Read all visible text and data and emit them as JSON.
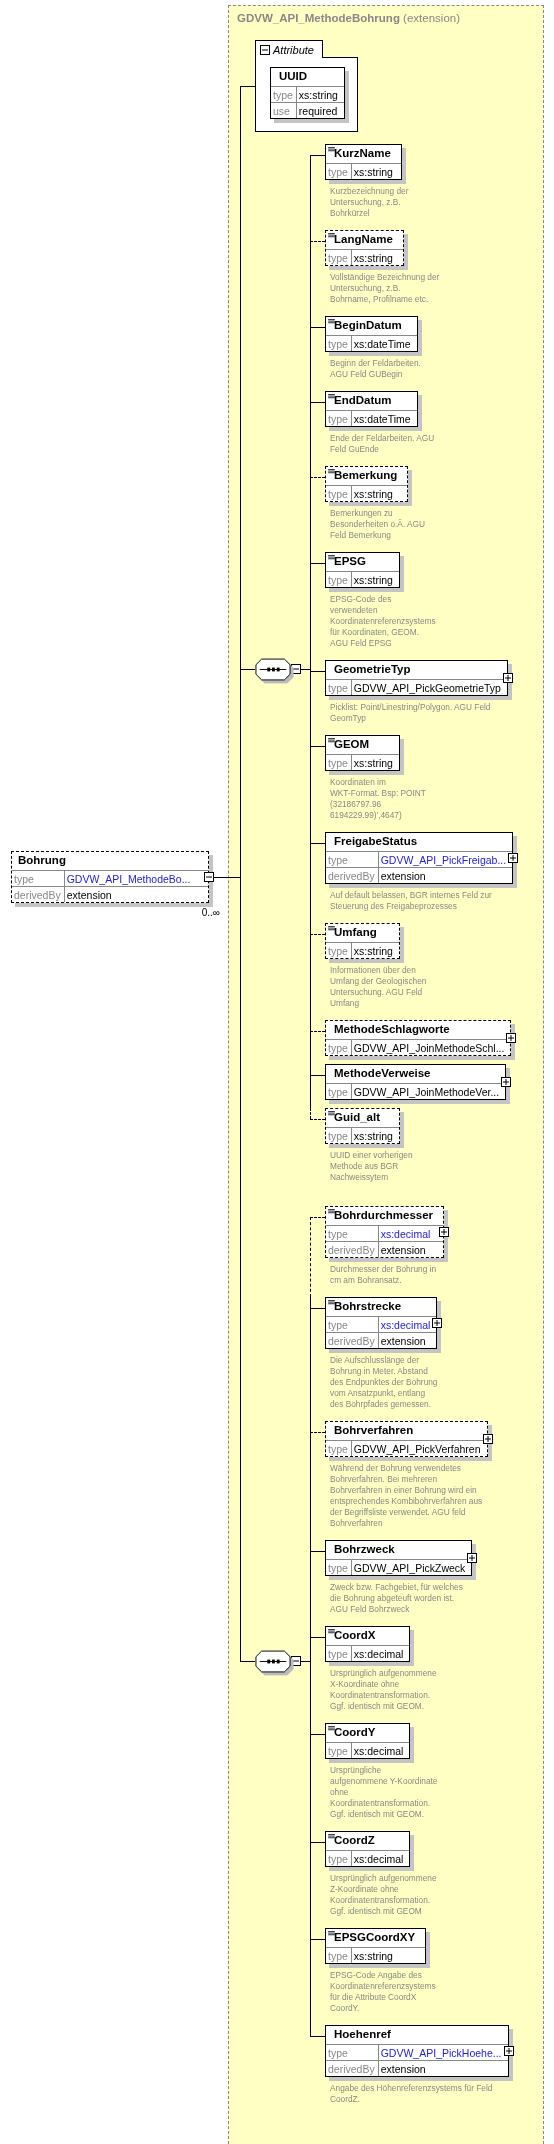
{
  "root": {
    "name": "Bohrung",
    "optional": true,
    "collapsible": true,
    "rows": [
      {
        "label": "type",
        "value": "GDVW_API_MethodeBo...",
        "link": true
      },
      {
        "label": "derivedBy",
        "value": "extension",
        "link": false
      }
    ],
    "occurrence": "0..∞"
  },
  "panel": {
    "title": "**GDVW_API_MethodeBohrung** (extension)",
    "attributes": {
      "label": "Attribute",
      "items": [
        {
          "name": "UUID",
          "rows": [
            {
              "label": "type",
              "value": "xs:string",
              "link": false
            },
            {
              "label": "use",
              "value": "required",
              "link": false
            }
          ]
        }
      ]
    },
    "sequences": [
      {
        "elements": [
          {
            "name": "KurzName",
            "optional": false,
            "annotated": true,
            "expandable": false,
            "rows": [
              {
                "label": "type",
                "value": "xs:string",
                "link": false
              }
            ],
            "description": "Kurzbezeichnung der\nUntersuchung, z.B.\nBohrkürzel"
          },
          {
            "name": "LangName",
            "optional": true,
            "annotated": true,
            "expandable": false,
            "rows": [
              {
                "label": "type",
                "value": "xs:string",
                "link": false
              }
            ],
            "description": "Vollständige Bezeichnung der\nUntersuchung, z.B.\nBohrname, Profilname etc."
          },
          {
            "name": "BeginDatum",
            "optional": false,
            "annotated": true,
            "expandable": false,
            "rows": [
              {
                "label": "type",
                "value": "xs:dateTime",
                "link": false
              }
            ],
            "description": "Beginn der Feldarbeiten.\nAGU Feld GUBegin"
          },
          {
            "name": "EndDatum",
            "optional": false,
            "annotated": true,
            "expandable": false,
            "rows": [
              {
                "label": "type",
                "value": "xs:dateTime",
                "link": false
              }
            ],
            "description": "Ende der Feldarbeiten. AGU\nFeld GuEnde"
          },
          {
            "name": "Bemerkung",
            "optional": true,
            "annotated": true,
            "expandable": false,
            "rows": [
              {
                "label": "type",
                "value": "xs:string",
                "link": false
              }
            ],
            "description": "Bemerkungen zu\nBesonderheiten o.Ä. AGU\nFeld Bemerkung"
          },
          {
            "name": "EPSG",
            "optional": false,
            "annotated": true,
            "expandable": false,
            "rows": [
              {
                "label": "type",
                "value": "xs:string",
                "link": false
              }
            ],
            "description": "EPSG-Code des\nverwendeten\nKoordinatenreferenzsystems\nfür Koordinaten, GEOM.\nAGU Feld EPSG"
          },
          {
            "name": "GeometrieTyp",
            "optional": false,
            "annotated": false,
            "expandable": true,
            "rows": [
              {
                "label": "type",
                "value": "GDVW_API_PickGeometrieTyp",
                "link": false
              }
            ],
            "description": "Picklist: Point/Linestring/Polygon. AGU Feld\nGeomTyp"
          },
          {
            "name": "GEOM",
            "optional": false,
            "annotated": true,
            "expandable": false,
            "rows": [
              {
                "label": "type",
                "value": "xs:string",
                "link": false
              }
            ],
            "description": "Koordinaten im\nWKT-Format. Bsp: POINT\n(32186797.96\n6194229.99)',4647)"
          },
          {
            "name": "FreigabeStatus",
            "optional": false,
            "annotated": false,
            "expandable": true,
            "rows": [
              {
                "label": "type",
                "value": "GDVW_API_PickFreigab...",
                "link": true
              },
              {
                "label": "derivedBy",
                "value": "extension",
                "link": false
              }
            ],
            "description": "Auf default belassen, BGR internes Feld zur\nSteuerung des Freigabeprozesses"
          },
          {
            "name": "Umfang",
            "optional": true,
            "annotated": true,
            "expandable": false,
            "rows": [
              {
                "label": "type",
                "value": "xs:string",
                "link": false
              }
            ],
            "description": "Informationen über den\nUmfang der Geologischen\nUntersuchung. AGU Feld\nUmfang"
          },
          {
            "name": "MethodeSchlagworte",
            "optional": true,
            "annotated": false,
            "expandable": true,
            "rows": [
              {
                "label": "type",
                "value": "GDVW_API_JoinMethodeSchl...",
                "link": false
              }
            ]
          },
          {
            "name": "MethodeVerweise",
            "optional": false,
            "annotated": false,
            "expandable": true,
            "rows": [
              {
                "label": "type",
                "value": "GDVW_API_JoinMethodeVer...",
                "link": false
              }
            ]
          },
          {
            "name": "Guid_alt",
            "optional": true,
            "annotated": true,
            "expandable": false,
            "rows": [
              {
                "label": "type",
                "value": "xs:string",
                "link": false
              }
            ],
            "description": "UUID einer vorherigen\nMethode aus BGR\nNachweissytem"
          }
        ]
      },
      {
        "elements": [
          {
            "name": "Bohrdurchmesser",
            "optional": true,
            "annotated": true,
            "expandable": true,
            "rows": [
              {
                "label": "type",
                "value": "xs:decimal",
                "link": true
              },
              {
                "label": "derivedBy",
                "value": "extension",
                "link": false
              }
            ],
            "description": "Durchmesser der Bohrung in\ncm am Bohransatz."
          },
          {
            "name": "Bohrstrecke",
            "optional": false,
            "annotated": true,
            "expandable": true,
            "rows": [
              {
                "label": "type",
                "value": "xs:decimal",
                "link": true
              },
              {
                "label": "derivedBy",
                "value": "extension",
                "link": false
              }
            ],
            "description": "Die Aufschlusslänge der\nBohrung in Meter. Abstand\ndes Endpunktes der Bohrung\nvom Ansatzpunkt, entlang\ndes Bohrpfades gemessen."
          },
          {
            "name": "Bohrverfahren",
            "optional": true,
            "annotated": false,
            "expandable": true,
            "rows": [
              {
                "label": "type",
                "value": "GDVW_API_PickVerfahren",
                "link": false
              }
            ],
            "description": "Während der Bohrung verwendetes\nBohrverfahren. Bei mehreren\nBohrverfahren in einer Bohrung wird ein\nentsprechendes Kombibohrverfahren aus\nder Begriffsliste verwendet. AGU feld\nBohrverfahren"
          },
          {
            "name": "Bohrzweck",
            "optional": false,
            "annotated": false,
            "expandable": true,
            "rows": [
              {
                "label": "type",
                "value": "GDVW_API_PickZweck",
                "link": false
              }
            ],
            "description": "Zweck bzw. Fachgebiet, für welches\ndie Bohrung abgeteuft worden ist.\nAGU Feld Bohrzweck"
          },
          {
            "name": "CoordX",
            "optional": false,
            "annotated": true,
            "expandable": false,
            "rows": [
              {
                "label": "type",
                "value": "xs:decimal",
                "link": false
              }
            ],
            "description": "Ursprünglich aufgenommene\nX-Koordinate ohne\nKoordinatentransformation.\nGgf. identisch mit GEOM."
          },
          {
            "name": "CoordY",
            "optional": false,
            "annotated": true,
            "expandable": false,
            "rows": [
              {
                "label": "type",
                "value": "xs:decimal",
                "link": false
              }
            ],
            "description": "Ursprüngliche\naufgenommene Y-Koordinate\nohne\nKoordinatentransformation.\nGgf. identisch mit GEOM."
          },
          {
            "name": "CoordZ",
            "optional": false,
            "annotated": true,
            "expandable": false,
            "rows": [
              {
                "label": "type",
                "value": "xs:decimal",
                "link": false
              }
            ],
            "description": "Ursprünglich aufgenommene\nZ-Koordinate ohne\nKoordinatentransformation.\nGgf. identisch mit GEOM"
          },
          {
            "name": "EPSGCoordXY",
            "optional": false,
            "annotated": true,
            "expandable": false,
            "rows": [
              {
                "label": "type",
                "value": "xs:string",
                "link": false
              }
            ],
            "description": "EPSG-Code Angabe des\nKoordinatenreferenzsystems\nfür die Attribute CoordX\nCoordY."
          },
          {
            "name": "Hoehenref",
            "optional": false,
            "annotated": false,
            "expandable": true,
            "rows": [
              {
                "label": "type",
                "value": "GDVW_API_PickHoehe...",
                "link": true
              },
              {
                "label": "derivedBy",
                "value": "extension",
                "link": false
              }
            ],
            "description": "Angabe des Höhenreferenzsystems für Feld\nCoordZ."
          }
        ]
      }
    ]
  }
}
